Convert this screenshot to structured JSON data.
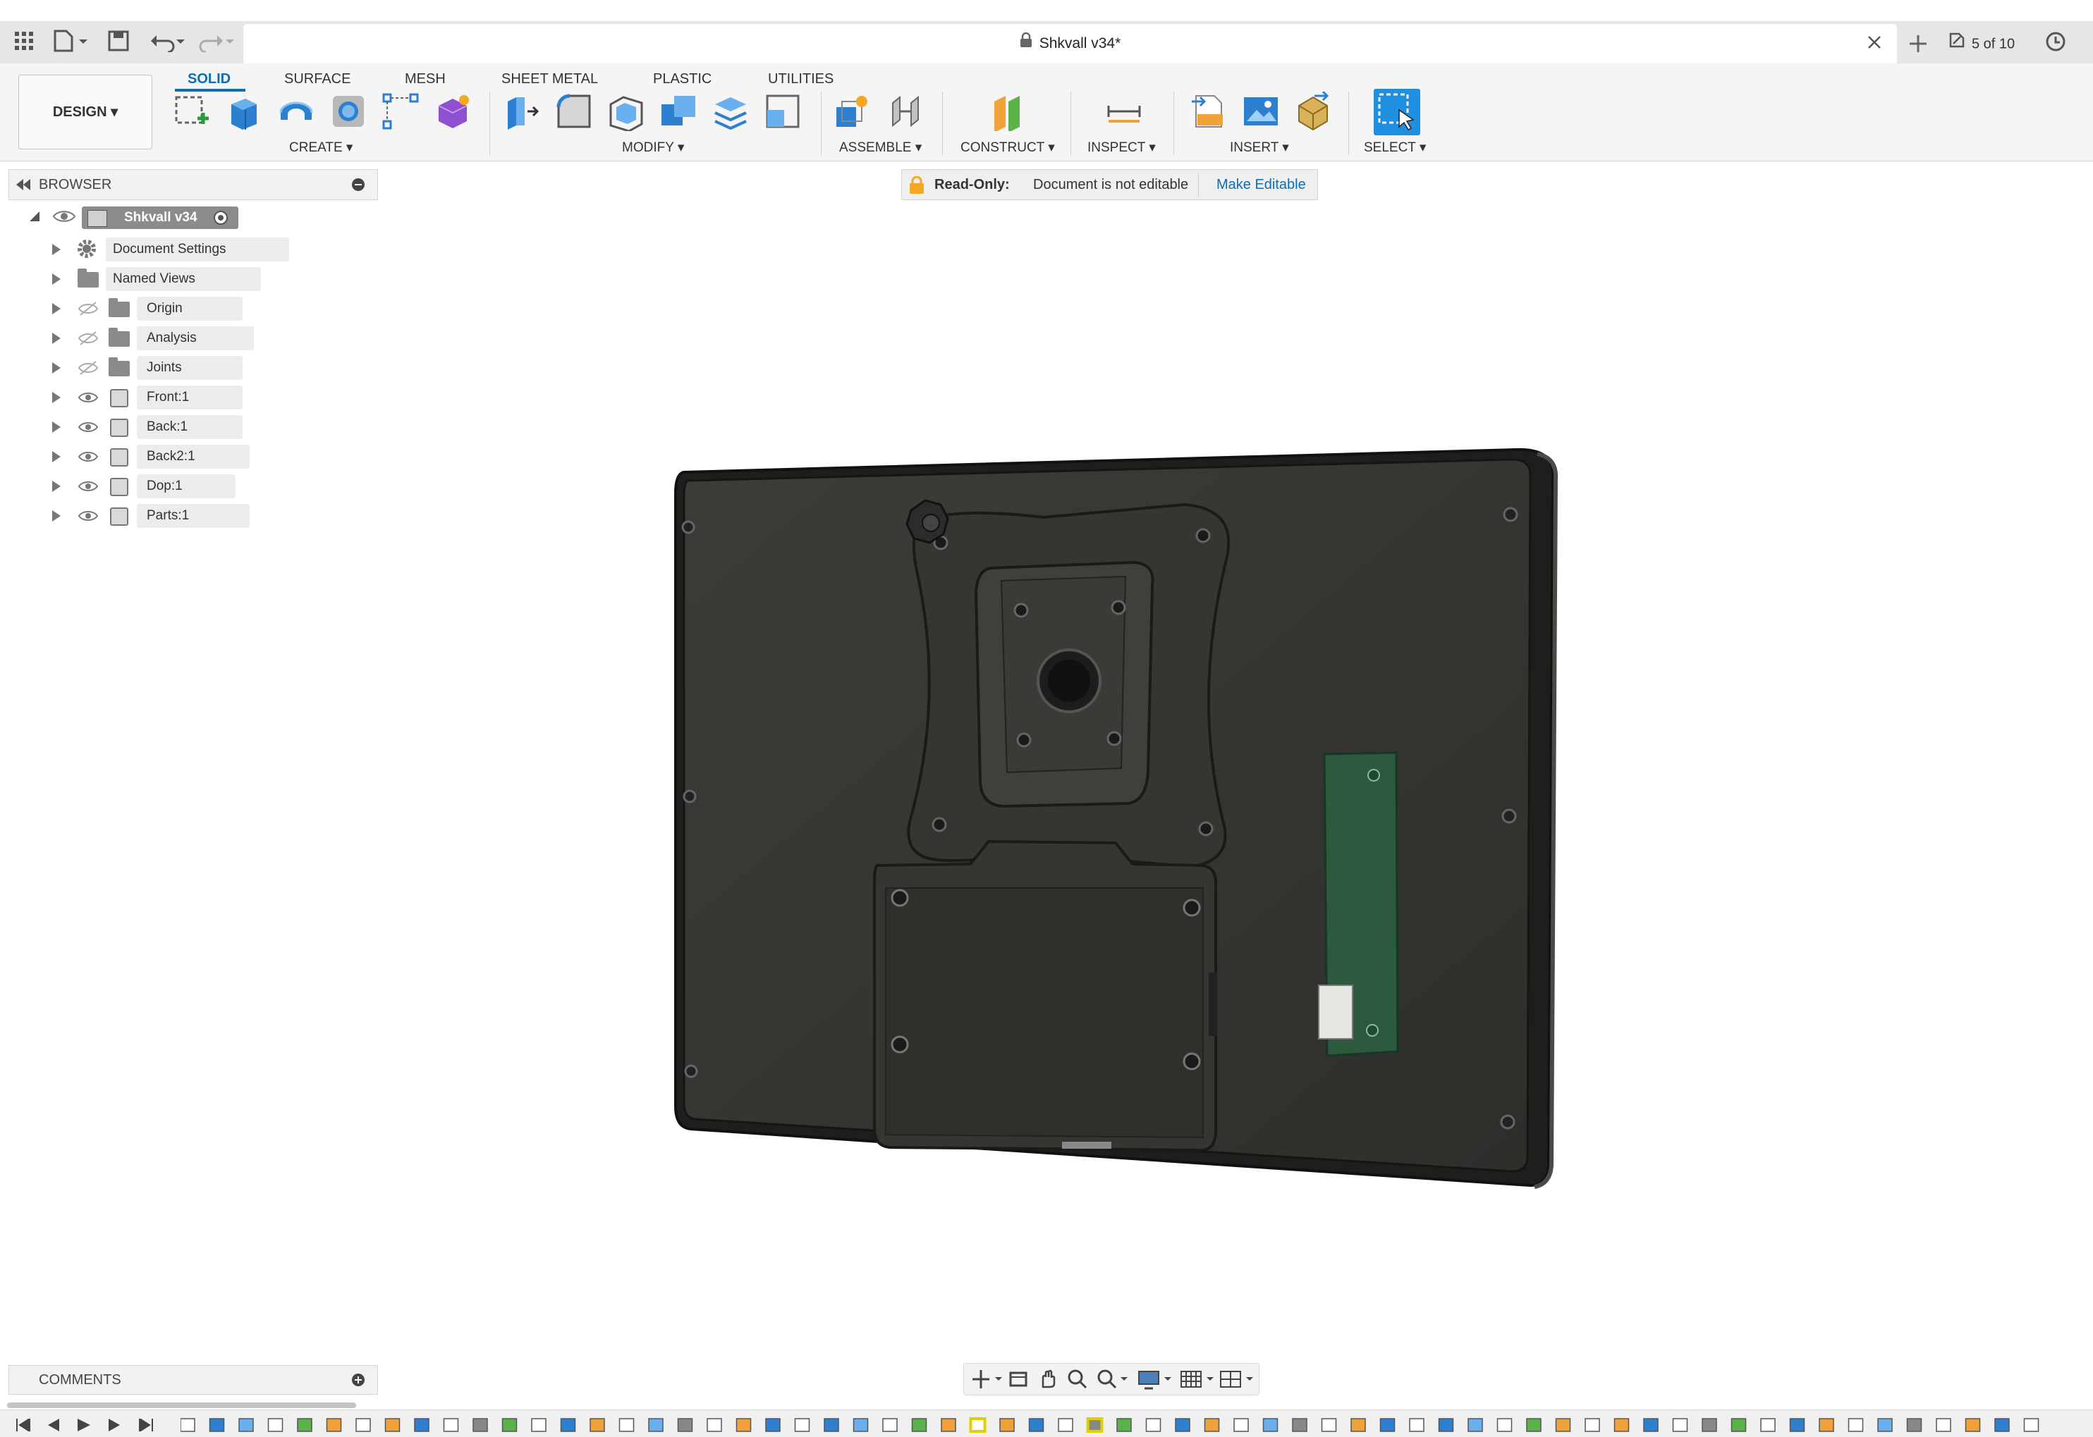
{
  "app": {
    "document_title": "Shkvall v34*",
    "version_indicator": "5 of 10"
  },
  "ribbon": {
    "tabs": [
      {
        "label": "SOLID",
        "active": true
      },
      {
        "label": "SURFACE",
        "active": false
      },
      {
        "label": "MESH",
        "active": false
      },
      {
        "label": "SHEET METAL",
        "active": false
      },
      {
        "label": "PLASTIC",
        "active": false
      },
      {
        "label": "UTILITIES",
        "active": false
      }
    ],
    "workspace_label": "DESIGN ▾",
    "groups": {
      "create": "CREATE ▾",
      "modify": "MODIFY ▾",
      "assemble": "ASSEMBLE ▾",
      "construct": "CONSTRUCT ▾",
      "inspect": "INSPECT ▾",
      "insert": "INSERT ▾",
      "select": "SELECT ▾"
    },
    "accent_color": "#0a6fb6"
  },
  "browser": {
    "title": "BROWSER",
    "root": "Shkvall v34",
    "items": [
      {
        "label": "Document Settings",
        "icon": "gear-icon"
      },
      {
        "label": "Named Views",
        "icon": "folder-icon"
      },
      {
        "label": "Origin",
        "icon": "folder-icon",
        "visibility": "hidden"
      },
      {
        "label": "Analysis",
        "icon": "folder-icon",
        "visibility": "hidden"
      },
      {
        "label": "Joints",
        "icon": "folder-icon",
        "visibility": "hidden"
      },
      {
        "label": "Front:1",
        "icon": "component-icon",
        "visibility": "visible"
      },
      {
        "label": "Back:1",
        "icon": "component-icon",
        "visibility": "visible"
      },
      {
        "label": "Back2:1",
        "icon": "component-icon",
        "visibility": "visible"
      },
      {
        "label": "Dop:1",
        "icon": "component-icon",
        "visibility": "visible"
      },
      {
        "label": "Parts:1",
        "icon": "component-icon",
        "visibility": "visible"
      }
    ]
  },
  "readonly_banner": {
    "label": "Read-Only:",
    "message": "Document is not editable",
    "action": "Make Editable"
  },
  "comments": {
    "title": "COMMENTS"
  }
}
